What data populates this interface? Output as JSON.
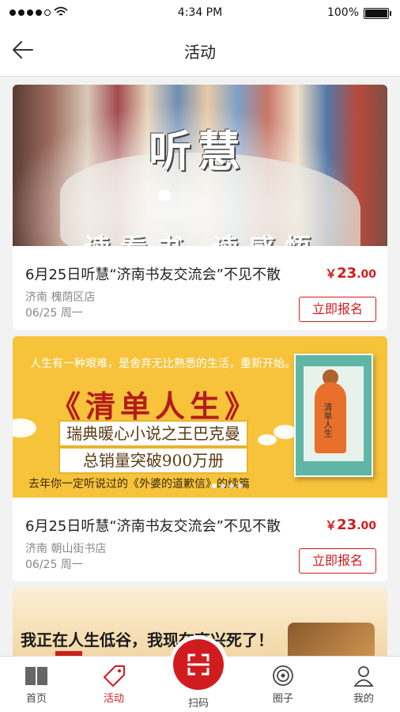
{
  "status_bar": {
    "time": "4:34 PM",
    "battery": "100%",
    "battery_level": 1.0
  },
  "header": {
    "title": "活动"
  },
  "events": [
    {
      "banner_title": "听慧",
      "banner_sub": "读看书 读感悟",
      "title": "6月25日听慧“济南书友交流会”不见不散",
      "price_symbol": "￥",
      "price_int": "23",
      "price_dec": ".00",
      "location": "济南 槐荫区店",
      "date": "06/25 周一",
      "button": "立即报名"
    },
    {
      "banner_quote": "人生有一种艰难，是舍弃无比熟悉的生活，重新开始。",
      "banner_title": "《清单人生》",
      "banner_line1": "瑞典暖心小说之王巴克曼",
      "banner_line2": "总销量突破900万册",
      "banner_foot": "去年你一定听说过的《外婆的道歉信》的续篇",
      "book_title": "清单人生",
      "title": "6月25日听慧“济南书友交流会”不见不散",
      "price_symbol": "￥",
      "price_int": "23",
      "price_dec": ".00",
      "location": "济南 朝山街书店",
      "date": "06/25 周一",
      "button": "立即报名"
    },
    {
      "banner_headline": "我正在人生低谷，我现在高兴死了！"
    }
  ],
  "tabbar": {
    "home": "首页",
    "activity": "活动",
    "scan": "扫码",
    "circle": "圈子",
    "mine": "我的"
  },
  "colors": {
    "accent": "#d01c1f",
    "banner2_bg": "#f6c33b"
  }
}
